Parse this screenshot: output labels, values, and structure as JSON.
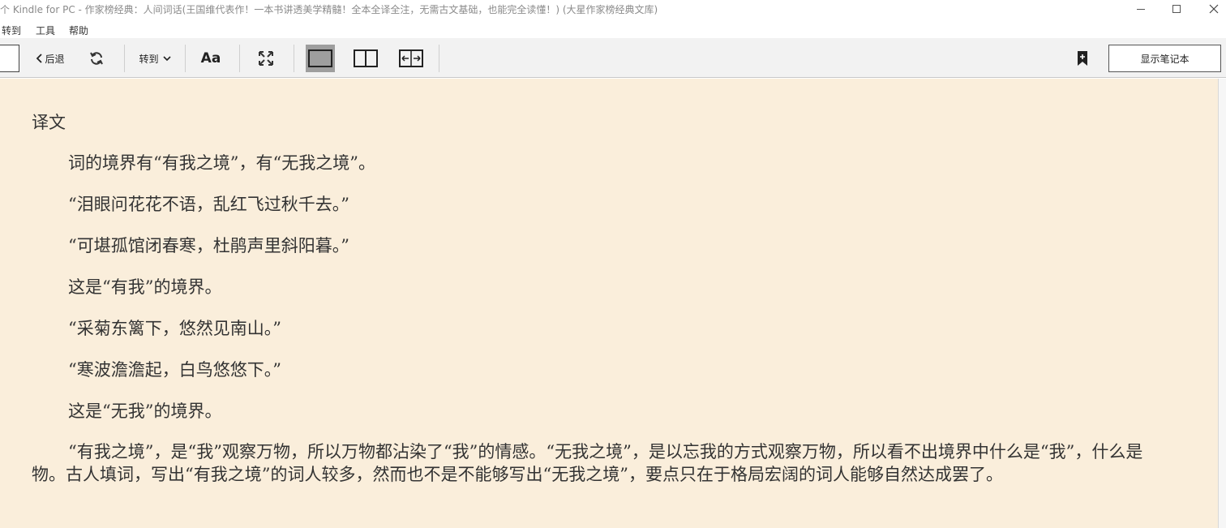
{
  "window": {
    "title": "个 Kindle for PC - 作家榜经典：人间词话(王国维代表作！一本书讲透美学精髓！全本全译全注，无需古文基础，也能完全读懂！) (大星作家榜经典文库)"
  },
  "menu": [
    "转到",
    "工具",
    "帮助"
  ],
  "toolbar": {
    "back_label": "后退",
    "goto_label": "转到",
    "font_label": "Aa",
    "notes_label": "显示笔记本"
  },
  "book": {
    "heading": "译文",
    "paragraphs": [
      "词的境界有“有我之境”，有“无我之境”。",
      "“泪眼问花花不语，乱红飞过秋千去。”",
      "“可堪孤馆闭春寒，杜鹃声里斜阳暮。”",
      "这是“有我”的境界。",
      "“采菊东篱下，悠然见南山。”",
      "“寒波澹澹起，白鸟悠悠下。”",
      "这是“无我”的境界。"
    ],
    "long_paragraph": "“有我之境”，是“我”观察万物，所以万物都沾染了“我”的情感。“无我之境”，是以忘我的方式观察万物，所以看不出境界中什么是“我”，什么是物。古人填词，写出“有我之境”的词人较多，然而也不是不能够写出“无我之境”，要点只在于格局宏阔的词人能够自然达成罢了。"
  },
  "colors": {
    "page_background": "#faeedb",
    "toolbar_background": "#f2f2f2",
    "text": "#333333",
    "active_view": "#9e9e9e"
  },
  "icons": [
    "back-chevron-icon",
    "sync-icon",
    "chevron-down-icon",
    "fullscreen-icon",
    "single-page-icon",
    "two-page-icon",
    "fit-width-icon",
    "add-bookmark-icon"
  ]
}
